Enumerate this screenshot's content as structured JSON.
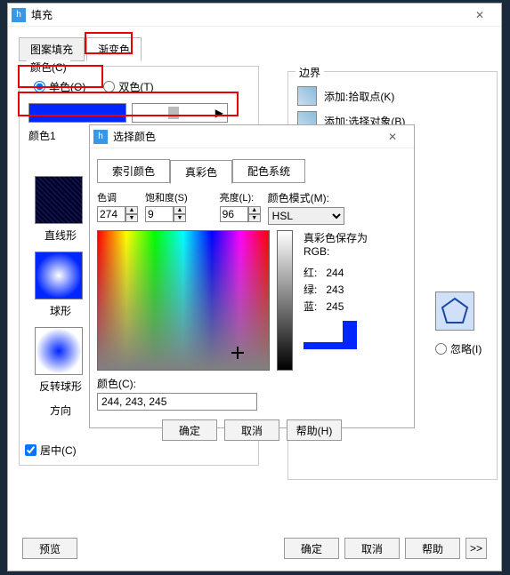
{
  "main": {
    "title": "填充",
    "tabs": {
      "pattern": "图案填充",
      "gradient": "渐变色"
    },
    "colorGroup": {
      "legend": "颜色(C)",
      "single": "单色(O)",
      "double": "双色(T)",
      "color1Label": "颜色1"
    },
    "swatches": {
      "s1": "直线形",
      "s2": "球形",
      "s3": "反转球形",
      "s4": "方向"
    },
    "center": "居中(C)",
    "boundary": {
      "legend": "边界",
      "addPick": "添加:拾取点(K)",
      "addSelect": "添加:选择对象(B)"
    },
    "ignore": "忽略(I)",
    "buttons": {
      "preview": "预览",
      "ok": "确定",
      "cancel": "取消",
      "help": "帮助",
      "expand": ">>"
    }
  },
  "dlg": {
    "title": "选择颜色",
    "tabs": {
      "index": "索引颜色",
      "true": "真彩色",
      "system": "配色系统"
    },
    "labels": {
      "hue": "色调",
      "sat": "饱和度(S)",
      "lum": "亮度(L):",
      "mode": "颜色模式(M):",
      "saveAs": "真彩色保存为",
      "rgb": "RGB:",
      "r": "红:",
      "g": "绿:",
      "b": "蓝:",
      "colorC": "颜色(C):"
    },
    "values": {
      "hue": "274",
      "sat": "9",
      "lum": "96",
      "mode": "HSL",
      "r": "244",
      "g": "243",
      "b": "245",
      "rgbstr": "244, 243, 245"
    },
    "buttons": {
      "ok": "确定",
      "cancel": "取消",
      "help": "帮助(H)"
    }
  }
}
